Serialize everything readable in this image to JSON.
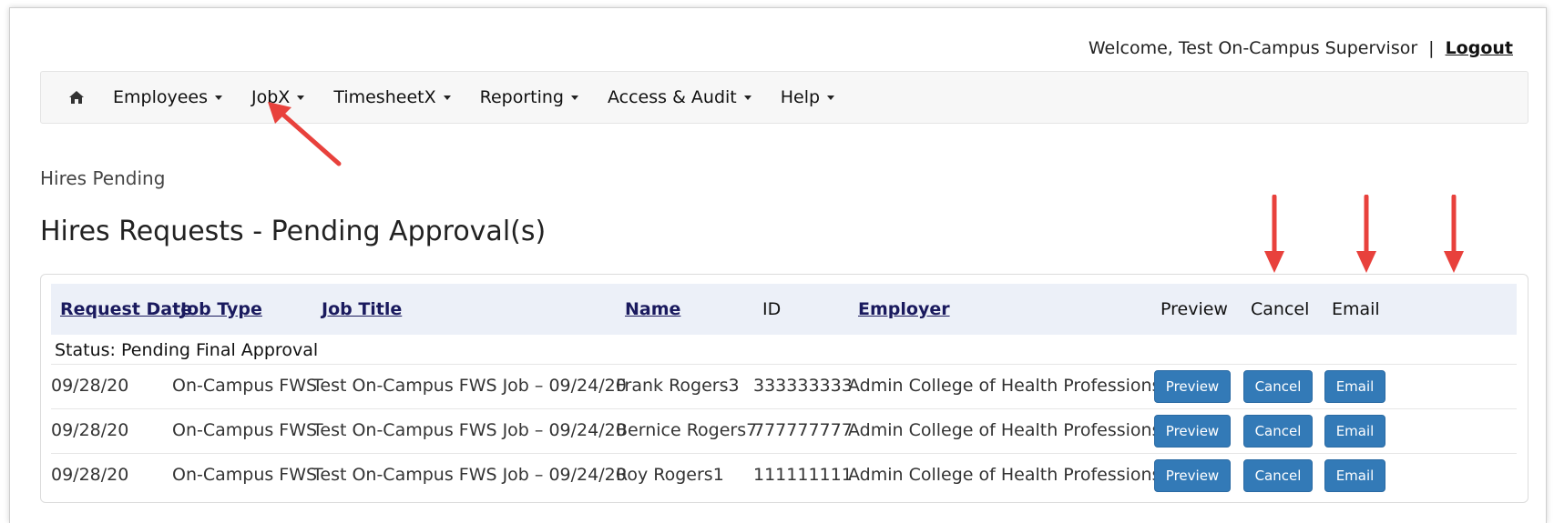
{
  "header": {
    "welcome_text": "Welcome, Test On-Campus Supervisor",
    "separator": "|",
    "logout_label": "Logout"
  },
  "nav": {
    "home_icon": "home-icon",
    "items": [
      {
        "label": "Employees"
      },
      {
        "label": "JobX"
      },
      {
        "label": "TimesheetX"
      },
      {
        "label": "Reporting"
      },
      {
        "label": "Access & Audit"
      },
      {
        "label": "Help"
      }
    ]
  },
  "breadcrumb": "Hires Pending",
  "page_title": "Hires Requests - Pending Approval(s)",
  "table": {
    "columns": [
      "Request Date",
      "Job Type",
      "Job Title",
      "Name",
      "ID",
      "Employer",
      "Preview",
      "Cancel",
      "Email"
    ],
    "status_label": "Status: Pending Final Approval",
    "rows": [
      {
        "date": "09/28/20",
        "job_type": "On-Campus FWS",
        "job_title": "Test On-Campus FWS Job – 09/24/20",
        "name": "Frank Rogers3",
        "id": "333333333",
        "employer": "Admin College of Health Professions",
        "preview": "Preview",
        "cancel": "Cancel",
        "email": "Email"
      },
      {
        "date": "09/28/20",
        "job_type": "On-Campus FWS",
        "job_title": "Test On-Campus FWS Job – 09/24/20",
        "name": "Bernice Rogers7",
        "id": "777777777",
        "employer": "Admin College of Health Professions",
        "preview": "Preview",
        "cancel": "Cancel",
        "email": "Email"
      },
      {
        "date": "09/28/20",
        "job_type": "On-Campus FWS",
        "job_title": "Test On-Campus FWS Job – 09/24/20",
        "name": "Roy Rogers1",
        "id": "111111111",
        "employer": "Admin College of Health Professions",
        "preview": "Preview",
        "cancel": "Cancel",
        "email": "Email"
      }
    ]
  },
  "colors": {
    "button_blue": "#337ab7",
    "table_header_bg": "#ecf0f8",
    "annotation_arrow": "#e8413c"
  }
}
